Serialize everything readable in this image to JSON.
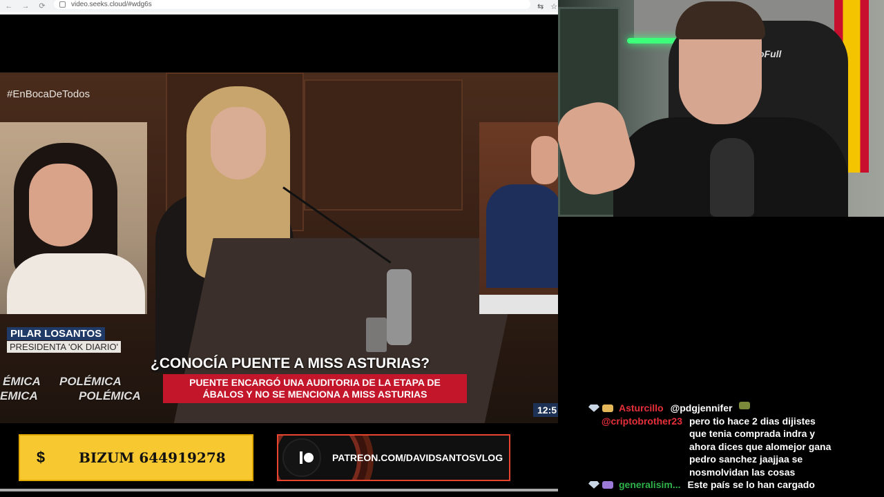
{
  "browser": {
    "back_icon": "←",
    "forward_icon": "→",
    "reload_icon": "⟳",
    "url": "video.seeks.cloud/#wdg6s",
    "translate_icon": "⇆",
    "star_icon": "☆"
  },
  "video": {
    "hashtag": "#EnBocaDeTodos",
    "guest_name": "PILAR LOSANTOS",
    "guest_role": "PRESIDENTA 'OK DIARIO'",
    "ticker_words": [
      "ÉMICA",
      "POLÉMICA",
      "EMICA",
      "POLÉMICA"
    ],
    "headline": "¿CONOCÍA PUENTE A MISS ASTURIAS?",
    "subheadline_line1": "PUENTE ENCARGÓ UNA AUDITORIA DE LA ETAPA DE",
    "subheadline_line2": "ÁBALOS Y NO SE MENCIONA A MISS ASTURIAS",
    "clock": "12:5"
  },
  "banners": {
    "bizum_icon": "$",
    "bizum_label": "BIZUM 644919278",
    "patreon_label": "PATREON.COM/DAVIDSANTOSVLOG"
  },
  "webcam": {
    "chair_brand": "oFull"
  },
  "chat": {
    "message1": {
      "user": "Asturcillo",
      "reply_to": "@pdgjennifer"
    },
    "message2": {
      "user": "@criptobrother23",
      "lines": [
        "pero tio hace 2 dias dijistes",
        "que tenia comprada indra y",
        "ahora dices que alomejor gana",
        "pedro sanchez jaajjaa se",
        "nosmolvidan las cosas"
      ]
    },
    "message3": {
      "user": "generalisim...",
      "text": "Este país se lo han cargado"
    }
  },
  "colors": {
    "chat_user_red": "#e8303a",
    "chat_user_green": "#2fb34a",
    "bizum_yellow": "#f7c82f",
    "patreon_border": "#e8442f",
    "news_red": "#c4162a",
    "news_blue": "#1f3a66"
  }
}
